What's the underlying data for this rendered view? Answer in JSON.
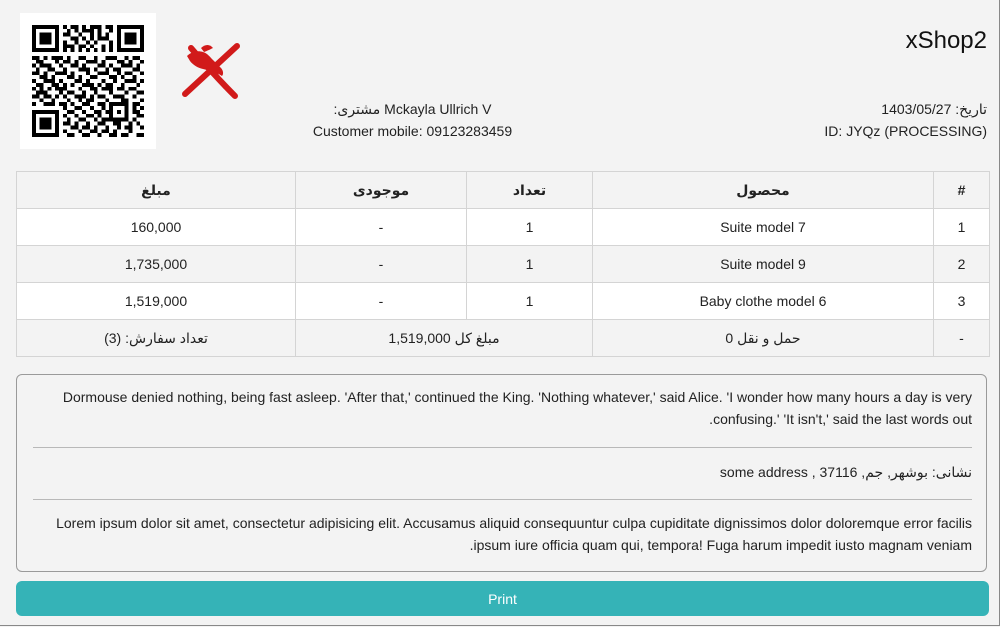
{
  "header": {
    "shop_name": "xShop2",
    "date_label": "تاریخ:",
    "date_value": "1403/05/27",
    "id_text": "ID: JYQz (PROCESSING)",
    "customer_label": "مشتری:",
    "customer_name": "Mckayla Ullrich V",
    "customer_mobile": "Customer mobile: 09123283459",
    "qr_icon": "qr-code-icon",
    "logo_icon": "crossed-bird-logo-icon"
  },
  "table": {
    "headers": [
      "#",
      "محصول",
      "تعداد",
      "موجودی",
      "مبلغ"
    ],
    "rows": [
      {
        "index": "1",
        "product": "Suite model 7",
        "qty": "1",
        "stock": "-",
        "amount": "160,000"
      },
      {
        "index": "2",
        "product": "Suite model 9",
        "qty": "1",
        "stock": "-",
        "amount": "1,735,000"
      },
      {
        "index": "3",
        "product": "Baby clothe model 6",
        "qty": "1",
        "stock": "-",
        "amount": "1,519,000"
      }
    ],
    "summary": {
      "index": "-",
      "shipping": "حمل و نقل 0",
      "total": "مبلغ کل 1,519,000",
      "order_count": "تعداد سفارش: (3)"
    }
  },
  "notes": {
    "description": "Dormouse denied nothing, being fast asleep. 'After that,' continued the King. 'Nothing whatever,' said Alice. 'I wonder how many hours a day is very confusing.' 'It isn't,' said the last words out.",
    "address": "نشانی: بوشهر, جم, 37116 , some address",
    "comment": "Lorem ipsum dolor sit amet, consectetur adipisicing elit. Accusamus aliquid consequuntur culpa cupiditate dignissimos dolor doloremque error facilis ipsum iure officia quam qui, tempora! Fuga harum impedit iusto magnam veniam."
  },
  "actions": {
    "print_label": "Print"
  },
  "colors": {
    "accent": "#35b3b7",
    "logo_red": "#d11a1a"
  }
}
